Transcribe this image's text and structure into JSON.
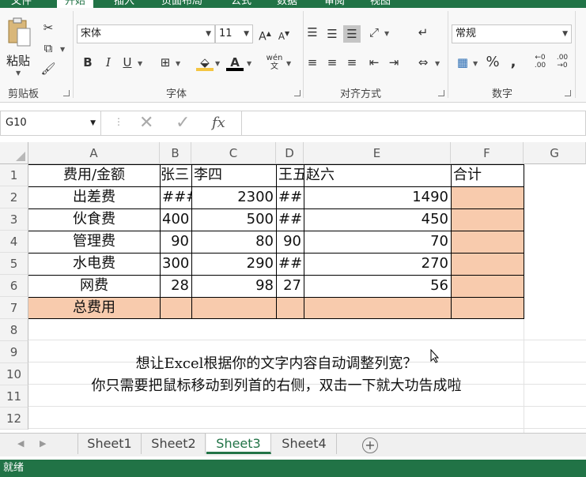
{
  "ribbon": {
    "tabs": [
      "文件",
      "开始",
      "插入",
      "页面布局",
      "公式",
      "数据",
      "审阅",
      "视图"
    ],
    "clipboard": {
      "paste_label": "粘贴",
      "group_label": "剪贴板"
    },
    "font": {
      "name": "宋体",
      "size": "11",
      "group_label": "字体",
      "bold": "B",
      "italic": "I",
      "underline": "U",
      "font_color_glyph": "A",
      "wen_glyph": "wén文"
    },
    "alignment": {
      "group_label": "对齐方式"
    },
    "number": {
      "format": "常规",
      "group_label": "数字",
      "percent": "%",
      "comma": ","
    }
  },
  "formula_bar": {
    "name_box": "G10",
    "fx": "fx",
    "value": ""
  },
  "grid": {
    "columns": [
      "A",
      "B",
      "C",
      "D",
      "E",
      "F",
      "G"
    ],
    "rows": [
      "1",
      "2",
      "3",
      "4",
      "5",
      "6",
      "7",
      "8",
      "9",
      "10",
      "11",
      "12"
    ],
    "headers": [
      "费用/金额",
      "张三",
      "李四",
      "王五",
      "赵六",
      "合计"
    ],
    "data": [
      [
        "出差费",
        "###",
        "2300",
        "##",
        "1490"
      ],
      [
        "伙食费",
        "400",
        "500",
        "##",
        "450"
      ],
      [
        "管理费",
        "90",
        "80",
        "90",
        "70"
      ],
      [
        "水电费",
        "300",
        "290",
        "##",
        "270"
      ],
      [
        "网费",
        "28",
        "98",
        "27",
        "56"
      ]
    ],
    "total_label": "总费用",
    "tip_lines": [
      "想让Excel根据你的文字内容自动调整列宽？",
      "你只需要把鼠标移动到列首的右侧，双击一下就大功告成啦"
    ]
  },
  "sheets": [
    "Sheet1",
    "Sheet2",
    "Sheet3",
    "Sheet4"
  ],
  "active_sheet": "Sheet3",
  "status": "就绪",
  "colors": {
    "accent": "#217346",
    "highlight_fill": "#f8cbad"
  }
}
